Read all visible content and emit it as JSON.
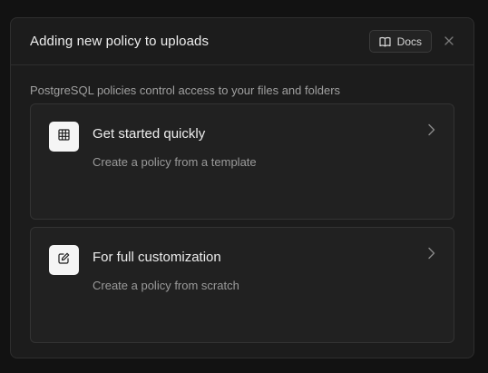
{
  "modal": {
    "title": "Adding new policy to uploads",
    "docs_label": "Docs",
    "description": "PostgreSQL policies control access to your files and folders"
  },
  "options": [
    {
      "title": "Get started quickly",
      "subtitle": "Create a policy from a template",
      "icon": "grid-icon"
    },
    {
      "title": "For full customization",
      "subtitle": "Create a policy from scratch",
      "icon": "edit-icon"
    }
  ],
  "colors": {
    "modal_background": "#1c1c1c",
    "card_background": "#212121",
    "icon_tile": "#f5f5f5",
    "border": "#2e2e2e"
  }
}
